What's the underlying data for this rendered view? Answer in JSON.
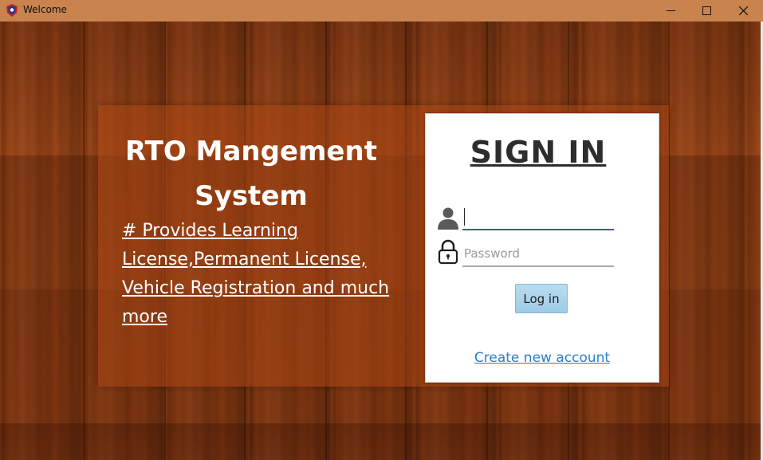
{
  "window": {
    "title": "Welcome",
    "icon": "app-shield-icon",
    "controls": [
      "minimize-icon",
      "maximize-icon",
      "close-icon"
    ]
  },
  "main": {
    "app_title": "RTO Mangement System",
    "tagline": "# Provides Learning License,Permanent License, Vehicle Registration and much more"
  },
  "signin": {
    "title": "SIGN IN",
    "username_value": "",
    "username_icon": "user-icon",
    "password_placeholder": "Password",
    "password_icon": "lock-icon",
    "login_label": "Log in",
    "create_account_label": "Create new account"
  },
  "colors": {
    "titlebar": "#c8834f",
    "card_overlay": "#aa4614",
    "login_button": "#a8d2ea",
    "link": "#2a7fc9",
    "active_underline": "#3e5aa8"
  }
}
